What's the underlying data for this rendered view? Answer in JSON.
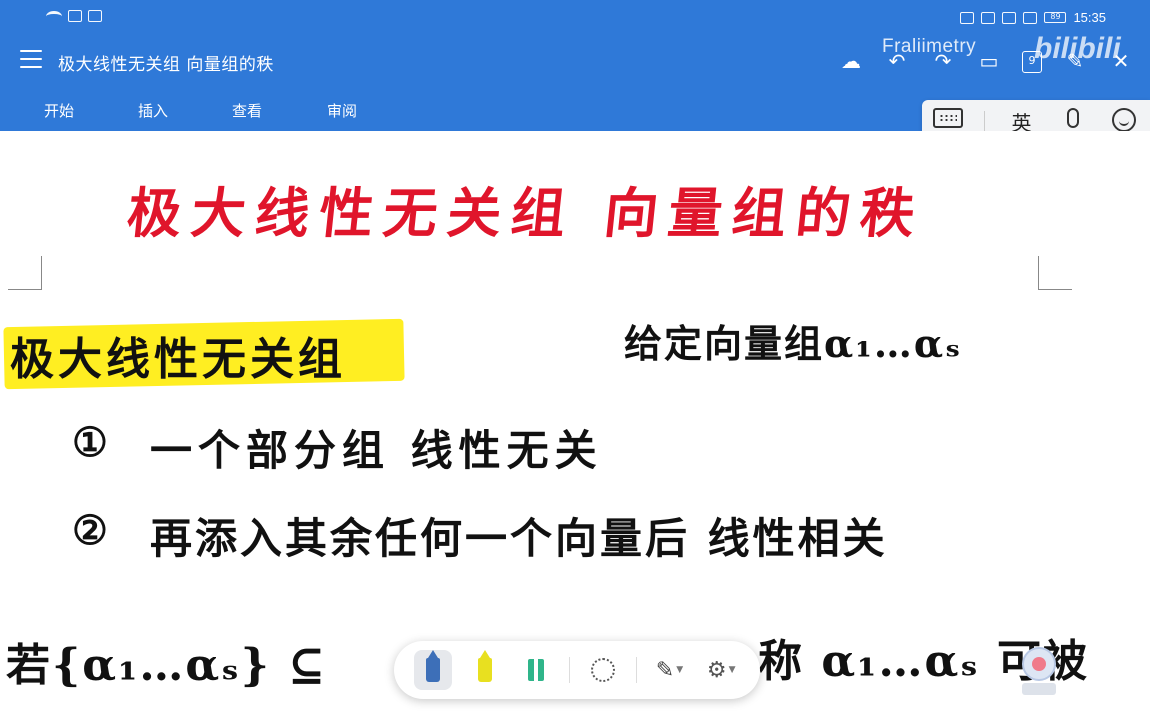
{
  "status_bar": {
    "time": "15:35",
    "battery": "89"
  },
  "title_bar": {
    "doc_title": "极大线性无关组 向量组的秩",
    "page_count": "9",
    "watermark": "Fraliimetry",
    "logo": "bilibili"
  },
  "ribbon": {
    "tabs": [
      "开始",
      "插入",
      "查看",
      "审阅"
    ]
  },
  "ime": {
    "language": "英"
  },
  "notes": {
    "title": "极大线性无关组 向量组的秩",
    "heading": "极大线性无关组",
    "given": "给定向量组α₁…αₛ",
    "cond1_num": "①",
    "cond1": "一个部分组 线性无关",
    "cond2_num": "②",
    "cond2": "再添入其余任何一个向量后 线性相关",
    "bottom_left": "若{α₁…αₛ} ⊆ ",
    "bottom_right": "称 α₁…αₛ 可被"
  },
  "colors": {
    "blue": "#2f79d8",
    "red_ink": "#e0152b",
    "highlight": "#ffee22"
  }
}
